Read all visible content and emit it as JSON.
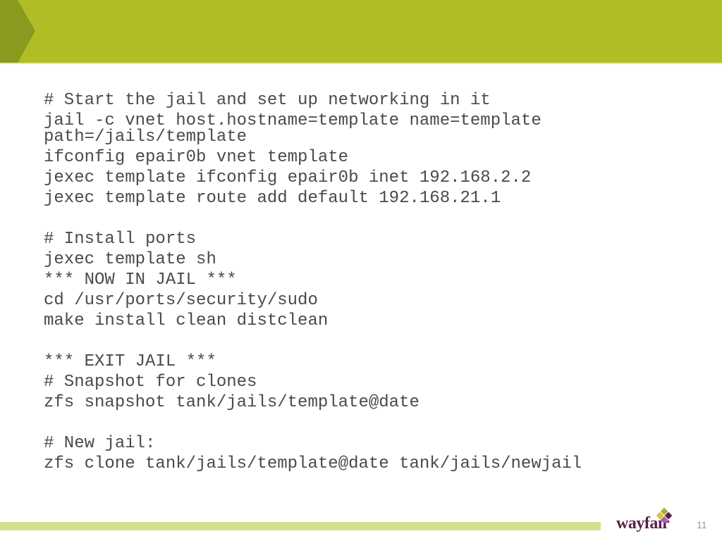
{
  "slide": {
    "page_number": "11",
    "brand": {
      "name": "wayfair",
      "text_color": "#5b1e48",
      "mark_colors": [
        "#9cb43a",
        "#5b1e48",
        "#e3c12b",
        "#a463b5"
      ]
    },
    "colors": {
      "header": "#b0bd25",
      "header_chevron": "#8a9a1e",
      "footer_bar": "#d3df8f",
      "text": "#4a4a4a"
    },
    "lines": [
      {
        "text": "# Start the jail and set up networking in it"
      },
      {
        "text": "jail -c vnet host.hostname=template name=template path=/jails/template",
        "wrap": true
      },
      {
        "text": "ifconfig epair0b vnet template"
      },
      {
        "text": "jexec template ifconfig epair0b inet 192.168.2.2"
      },
      {
        "text": "jexec template route add default 192.168.21.1"
      },
      {
        "text": ""
      },
      {
        "text": "# Install ports"
      },
      {
        "text": "jexec template sh"
      },
      {
        "text": "*** NOW IN JAIL ***"
      },
      {
        "text": "cd /usr/ports/security/sudo"
      },
      {
        "text": "make install clean distclean"
      },
      {
        "text": ""
      },
      {
        "text": "*** EXIT JAIL ***"
      },
      {
        "text": "# Snapshot for clones"
      },
      {
        "text": "zfs snapshot tank/jails/template@date"
      },
      {
        "text": ""
      },
      {
        "text": "# New jail:"
      },
      {
        "text": "zfs clone tank/jails/template@date tank/jails/newjail"
      }
    ]
  }
}
